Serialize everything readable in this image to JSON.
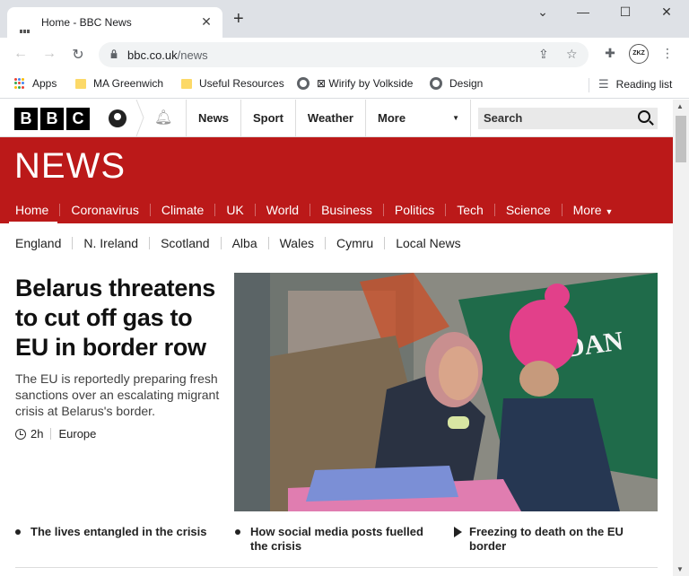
{
  "browser": {
    "tab_title": "Home - BBC News",
    "new_tab": "+",
    "url_host": "bbc.co.uk",
    "url_path": "/news",
    "profile": "ZKZ",
    "bookmarks": [
      "Apps",
      "MA Greenwich",
      "Useful Resources",
      "⊠ Wirify by Volkside",
      "Design"
    ],
    "reading_list": "Reading list"
  },
  "bbc": {
    "logo": [
      "B",
      "B",
      "C"
    ],
    "topnav": [
      "News",
      "Sport",
      "Weather",
      "More"
    ],
    "search_placeholder": "Search",
    "news_word": "NEWS",
    "brand_red": "#bb1919",
    "sections": [
      "Home",
      "Coronavirus",
      "Climate",
      "UK",
      "World",
      "Business",
      "Politics",
      "Tech",
      "Science",
      "More"
    ],
    "regions": [
      "England",
      "N. Ireland",
      "Scotland",
      "Alba",
      "Wales",
      "Cymru",
      "Local News"
    ]
  },
  "story": {
    "headline": "Belarus threatens to cut off gas to EU in border row",
    "summary": "The EU is reportedly preparing fresh sanctions over an escalating migrant crisis at Belarus's border.",
    "age": "2h",
    "section": "Europe",
    "related": [
      "The lives entangled in the crisis",
      "How social media posts fuelled the crisis",
      "Freezing to death on the EU border"
    ]
  }
}
